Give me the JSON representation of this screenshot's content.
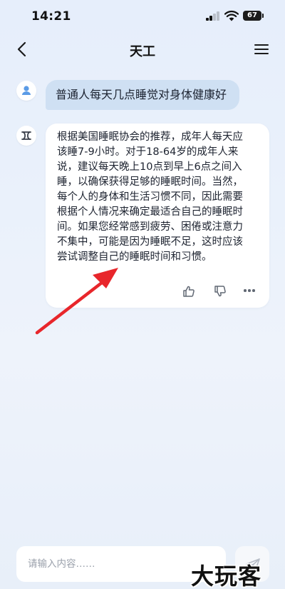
{
  "status_bar": {
    "time": "14:21",
    "battery": "67"
  },
  "nav": {
    "title": "天工"
  },
  "conversation": {
    "user_message": "普通人每天几点睡觉对身体健康好",
    "bot_message": "根据美国睡眠协会的推荐，成年人每天应\n该睡7-9小时。对于18-64岁的成年人来\n说，建议每天晚上10点到早上6点之间入\n睡，以确保获得足够的睡眠时间。当然，\n每个人的身体和生活习惯不同，因此需要\n根据个人情况来确定最适合自己的睡眠时\n间。如果您经常感到疲劳、困倦或注意力\n不集中，可能是因为睡眠不足，这时应该\n尝试调整自己的睡眠时间和习惯。"
  },
  "input": {
    "placeholder": "请输入内容……"
  },
  "watermark": "大玩客",
  "icons": {
    "back": "chevron-left-icon",
    "menu": "hamburger-menu-icon",
    "user_avatar": "person-icon",
    "bot_avatar": "tiangong-logo-icon",
    "like": "thumb-up-icon",
    "dislike": "thumb-down-icon",
    "more": "ellipsis-icon",
    "send": "send-icon"
  },
  "colors": {
    "user_bubble": "#cfe0f3",
    "accent": "#5b9be6",
    "annotation_arrow": "#e8262b"
  }
}
